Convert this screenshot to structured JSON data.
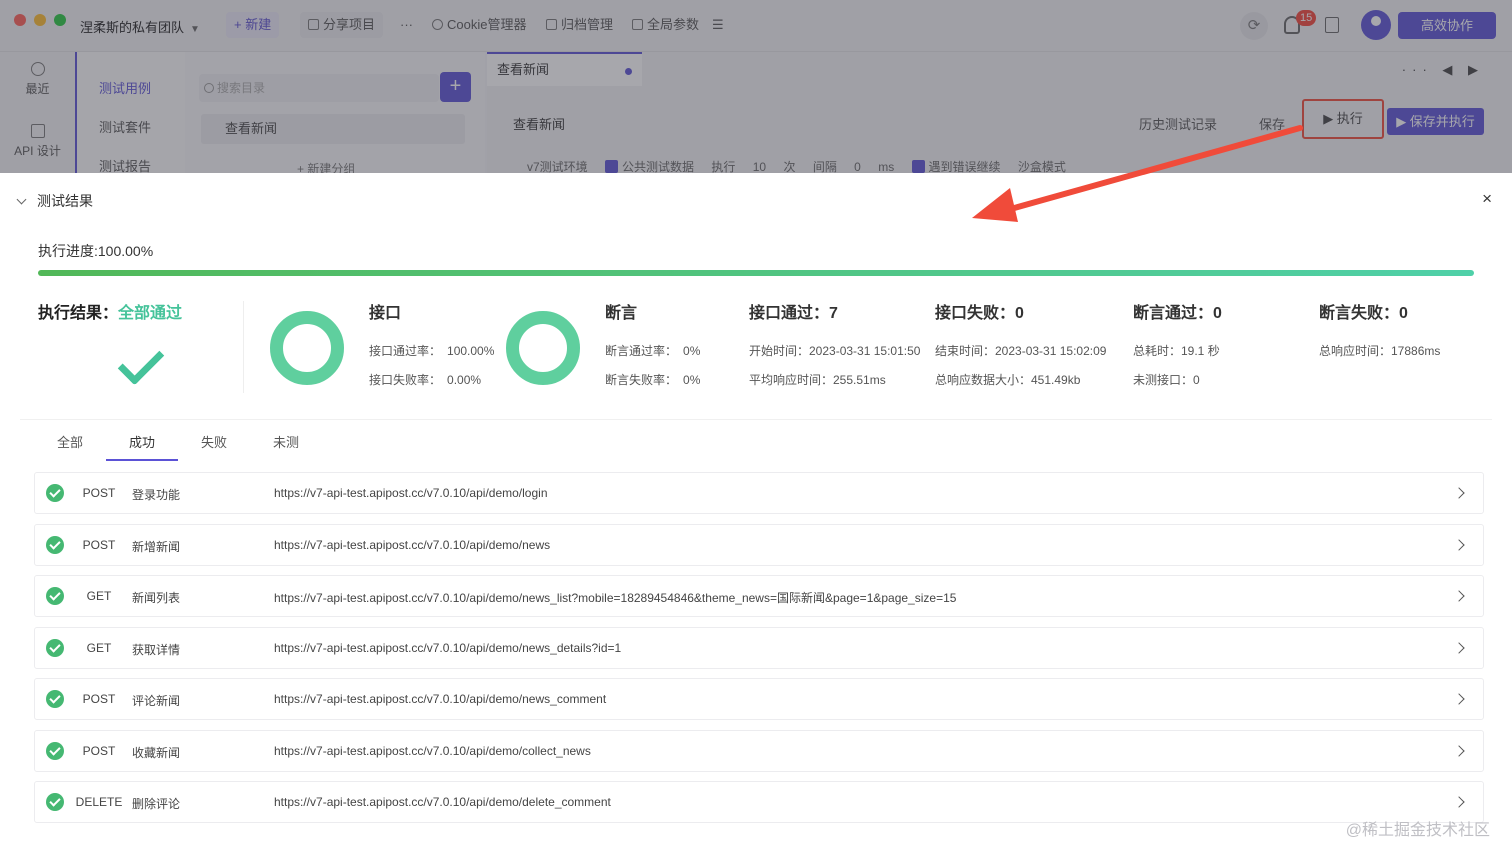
{
  "titlebar": {
    "team": "涅柔斯的私有团队",
    "new_label": "+ 新建",
    "share_label": "分享项目",
    "more_label": "···",
    "cookie_label": "Cookie管理器",
    "archive_label": "归档管理",
    "params_label": "全局参数",
    "list_label": "☰",
    "notification_count": "15",
    "collab_label": "高效协作"
  },
  "leftnav": {
    "recent": "最近",
    "api_design": "API 设计"
  },
  "subnav": {
    "items": [
      "测试用例",
      "测试套件",
      "测试报告"
    ]
  },
  "tree": {
    "search_placeholder": "搜索目录",
    "add": "+",
    "item": "查看新闻",
    "new_group": "+ 新建分组"
  },
  "editor": {
    "tab_label": "查看新闻",
    "tab_tools": "··· ◀ ▶",
    "case_title": "查看新闻",
    "history": "历史测试记录",
    "save": "保存",
    "run": "▶ 执行",
    "save_run": "▶ 保存并执行",
    "env": "v7测试环境",
    "shared_data": "公共测试数据",
    "exec": "执行",
    "exec_count": "10",
    "times": "次",
    "interval": "间隔",
    "interval_value": "0",
    "ms": "ms",
    "continue_on_error": "遇到错误继续",
    "sandbox": "沙盒模式"
  },
  "result": {
    "title": "测试结果",
    "close": "×",
    "progress_label": "执行进度:100.00%",
    "progress": 1.0,
    "summary_label": "执行结果：",
    "summary_value": "全部通过",
    "api_head": "接口",
    "api_pass_rate_label": "接口通过率：",
    "api_pass_rate": "100.00%",
    "api_fail_rate_label": "接口失败率：",
    "api_fail_rate": "0.00%",
    "assert_head": "断言",
    "assert_pass_rate_label": "断言通过率：",
    "assert_pass_rate": "0%",
    "assert_fail_rate_label": "断言失败率：",
    "assert_fail_rate": "0%",
    "api_pass": "接口通过：7",
    "api_fail": "接口失败：0",
    "assert_pass": "断言通过：0",
    "assert_fail": "断言失败：0",
    "start_time": "开始时间：2023-03-31 15:01:50",
    "end_time": "结束时间：2023-03-31 15:02:09",
    "total_time": "总耗时：19.1 秒",
    "total_response_time": "总响应时间：17886ms",
    "avg_response_time": "平均响应时间：255.51ms",
    "total_size": "总响应数据大小：451.49kb",
    "untested": "未测接口：0"
  },
  "filters": [
    "全部",
    "成功",
    "失败",
    "未测"
  ],
  "active_filter": "成功",
  "rows": [
    {
      "method": "POST",
      "name": "登录功能",
      "url": "https://v7-api-test.apipost.cc/v7.0.10/api/demo/login"
    },
    {
      "method": "POST",
      "name": "新增新闻",
      "url": "https://v7-api-test.apipost.cc/v7.0.10/api/demo/news"
    },
    {
      "method": "GET",
      "name": "新闻列表",
      "url": "https://v7-api-test.apipost.cc/v7.0.10/api/demo/news_list?mobile=18289454846&theme_news=国际新闻&page=1&page_size=15"
    },
    {
      "method": "GET",
      "name": "获取详情",
      "url": "https://v7-api-test.apipost.cc/v7.0.10/api/demo/news_details?id=1"
    },
    {
      "method": "POST",
      "name": "评论新闻",
      "url": "https://v7-api-test.apipost.cc/v7.0.10/api/demo/news_comment"
    },
    {
      "method": "POST",
      "name": "收藏新闻",
      "url": "https://v7-api-test.apipost.cc/v7.0.10/api/demo/collect_news"
    },
    {
      "method": "DELETE",
      "name": "删除评论",
      "url": "https://v7-api-test.apipost.cc/v7.0.10/api/demo/delete_comment"
    }
  ],
  "watermark": "@稀土掘金技术社区",
  "colors": {
    "accent": "#5b52d6",
    "success": "#45c39a",
    "annotation": "#f04b3a"
  }
}
